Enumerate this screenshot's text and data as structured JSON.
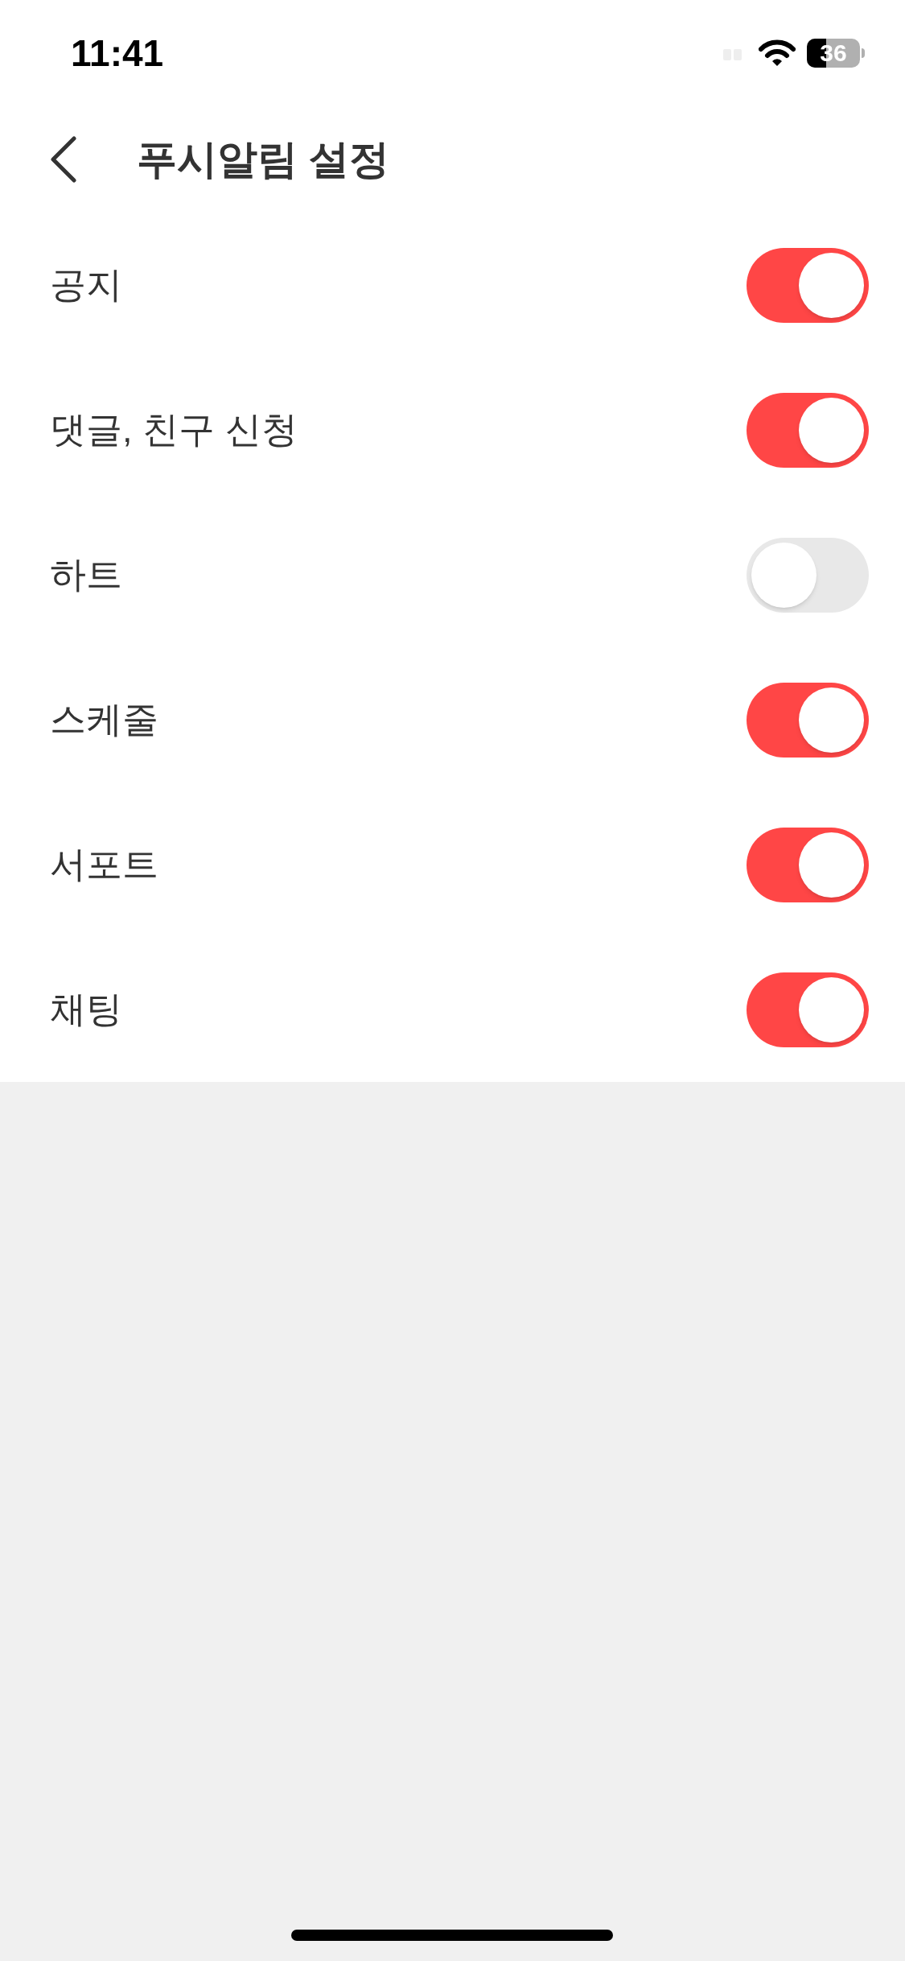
{
  "status_bar": {
    "time": "11:41",
    "battery": "36"
  },
  "header": {
    "title": "푸시알림 설정"
  },
  "settings": [
    {
      "label": "공지",
      "on": true
    },
    {
      "label": "댓글, 친구 신청",
      "on": true
    },
    {
      "label": "하트",
      "on": false
    },
    {
      "label": "스케줄",
      "on": true
    },
    {
      "label": "서포트",
      "on": true
    },
    {
      "label": "채팅",
      "on": true
    }
  ]
}
